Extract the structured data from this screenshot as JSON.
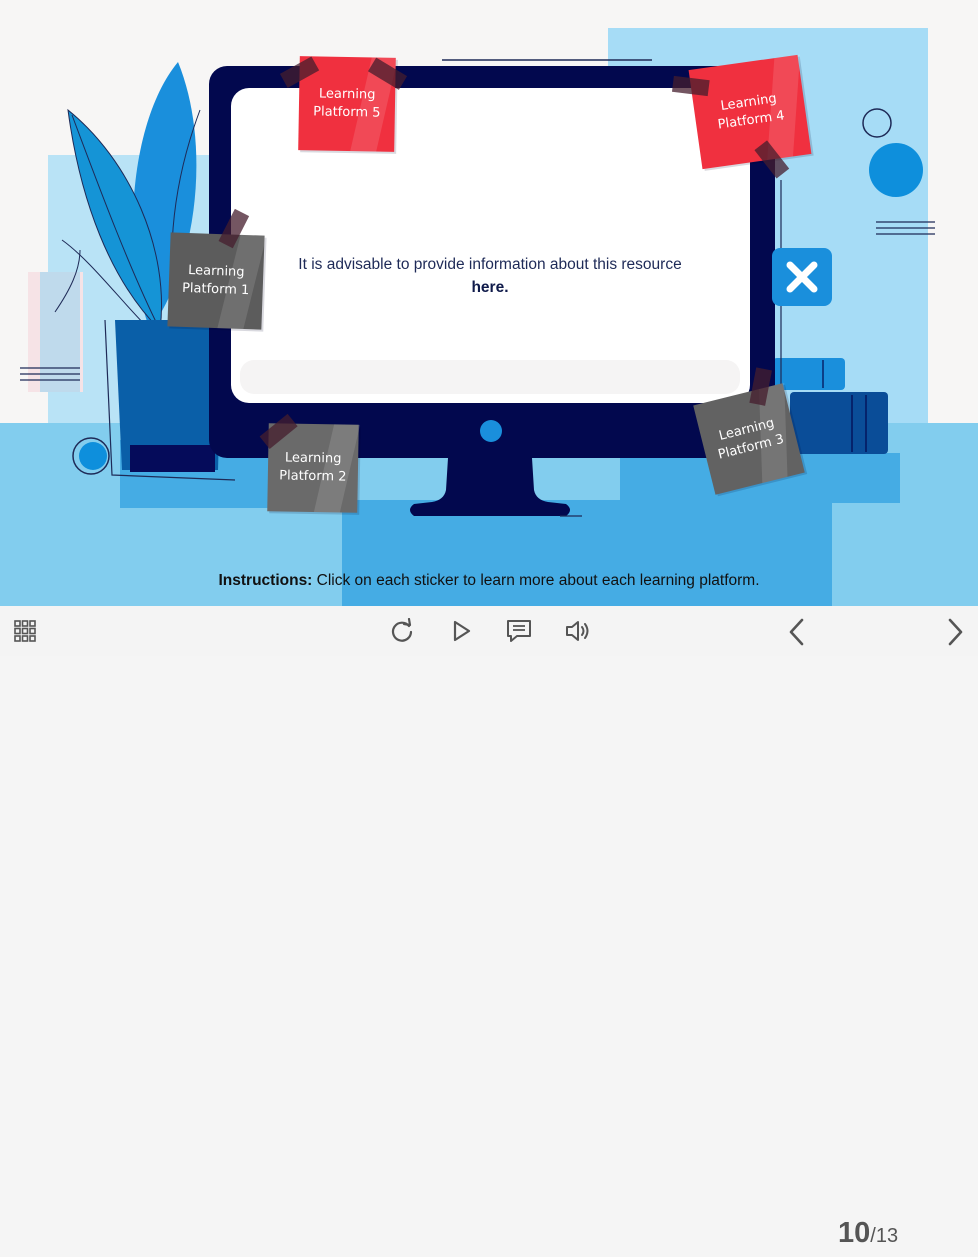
{
  "stickers": [
    {
      "label": "Learning Platform 1",
      "color": "#5c5c5c"
    },
    {
      "label": "Learning Platform 2",
      "color": "#6a6a6a"
    },
    {
      "label": "Learning Platform 3",
      "color": "#626262"
    },
    {
      "label": "Learning Platform 4",
      "color": "#f0303f"
    },
    {
      "label": "Learning Platform 5",
      "color": "#f0303f"
    }
  ],
  "screen": {
    "text_main": "It is advisable to provide information about this resource",
    "text_link": "here."
  },
  "instructions": {
    "label": "Instructions:",
    "text": "Click on each sticker to learn more about each learning platform."
  },
  "pager": {
    "current": "10",
    "total": "/13"
  },
  "icons": {
    "menu": "grid-menu-icon",
    "replay": "replay-icon",
    "play": "play-icon",
    "notes": "notes-icon",
    "audio": "volume-icon",
    "prev": "chevron-left-icon",
    "next": "chevron-right-icon",
    "close": "close-icon"
  },
  "colors": {
    "monitor": "#02084e",
    "accent_blue": "#0e8fdc",
    "light_blue": "#9ed8f4",
    "sticky_red": "#f0303f",
    "close_button": "#1a8fdc"
  }
}
